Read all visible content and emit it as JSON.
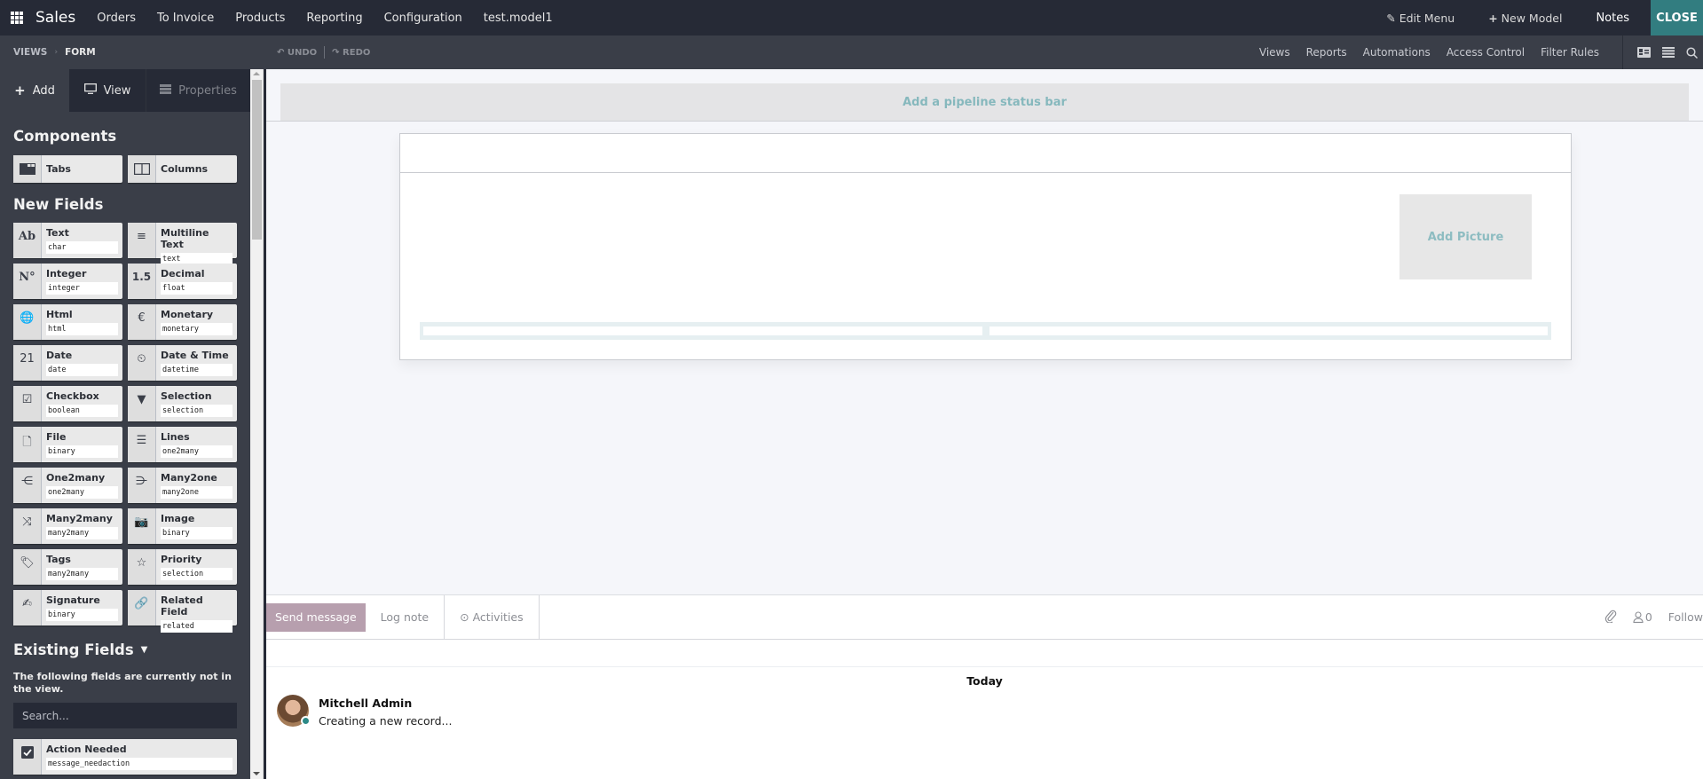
{
  "topbar": {
    "app_name": "Sales",
    "menu": [
      "Orders",
      "To Invoice",
      "Products",
      "Reporting",
      "Configuration",
      "test.model1"
    ],
    "edit_menu": "Edit Menu",
    "new_model": "New Model",
    "notes": "Notes",
    "close": "CLOSE",
    "accent_color": "#327d80"
  },
  "subbar": {
    "breadcrumb": [
      "VIEWS",
      "FORM"
    ],
    "undo": "UNDO",
    "redo": "REDO",
    "links": [
      "Views",
      "Reports",
      "Automations",
      "Access Control",
      "Filter Rules"
    ],
    "icons": [
      "form-view-icon",
      "list-view-icon",
      "search-icon"
    ]
  },
  "sidebar": {
    "tabs": [
      {
        "label": "Add",
        "icon": "plus-icon",
        "state": "active"
      },
      {
        "label": "View",
        "icon": "monitor-icon",
        "state": "normal"
      },
      {
        "label": "Properties",
        "icon": "properties-icon",
        "state": "disabled"
      }
    ],
    "components_title": "Components",
    "components": [
      {
        "label": "Tabs",
        "icon": "tabs-icon"
      },
      {
        "label": "Columns",
        "icon": "columns-icon"
      }
    ],
    "new_fields_title": "New Fields",
    "new_fields": [
      {
        "label": "Text",
        "type": "char",
        "icon": "Ab"
      },
      {
        "label": "Multiline Text",
        "type": "text",
        "icon": "≡"
      },
      {
        "label": "Integer",
        "type": "integer",
        "icon": "N°"
      },
      {
        "label": "Decimal",
        "type": "float",
        "icon": "1.5"
      },
      {
        "label": "Html",
        "type": "html",
        "icon": "🌐"
      },
      {
        "label": "Monetary",
        "type": "monetary",
        "icon": "€"
      },
      {
        "label": "Date",
        "type": "date",
        "icon": "21"
      },
      {
        "label": "Date & Time",
        "type": "datetime",
        "icon": "⏲"
      },
      {
        "label": "Checkbox",
        "type": "boolean",
        "icon": "☑"
      },
      {
        "label": "Selection",
        "type": "selection",
        "icon": "▼"
      },
      {
        "label": "File",
        "type": "binary",
        "icon": "🗋"
      },
      {
        "label": "Lines",
        "type": "one2many",
        "icon": "☰"
      },
      {
        "label": "One2many",
        "type": "one2many",
        "icon": "⋲"
      },
      {
        "label": "Many2one",
        "type": "many2one",
        "icon": "⋺"
      },
      {
        "label": "Many2many",
        "type": "many2many",
        "icon": "⤨"
      },
      {
        "label": "Image",
        "type": "binary",
        "icon": "📷"
      },
      {
        "label": "Tags",
        "type": "many2many",
        "icon": "🏷"
      },
      {
        "label": "Priority",
        "type": "selection",
        "icon": "☆"
      },
      {
        "label": "Signature",
        "type": "binary",
        "icon": "✍"
      },
      {
        "label": "Related Field",
        "type": "related",
        "icon": "🔗"
      }
    ],
    "existing_title": "Existing Fields",
    "existing_note": "The following fields are currently not in the view.",
    "search_placeholder": "Search...",
    "existing_fields": [
      {
        "label": "Action Needed",
        "type": "message_needaction",
        "icon": "☑"
      }
    ]
  },
  "canvas": {
    "pipeline_label": "Add a pipeline status bar",
    "add_picture": "Add Picture"
  },
  "chatter": {
    "send_message": "Send message",
    "log_note": "Log note",
    "activities": "Activities",
    "followers_count": "0",
    "follow": "Follow",
    "date_separator": "Today",
    "messages": [
      {
        "author": "Mitchell Admin",
        "body": "Creating a new record..."
      }
    ]
  }
}
